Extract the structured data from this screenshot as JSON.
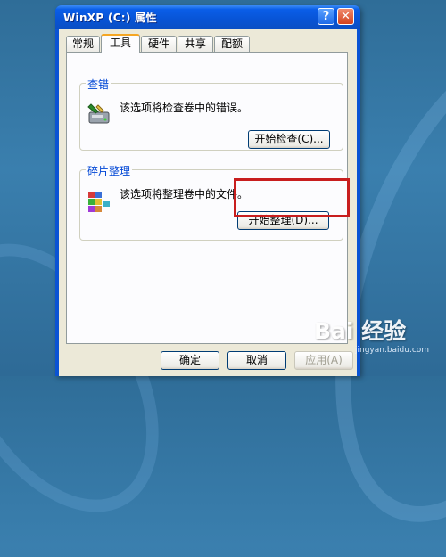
{
  "window": {
    "title": "WinXP (C:) 属性",
    "help_symbol": "?",
    "close_symbol": "✕"
  },
  "tabs": [
    {
      "label": "常规",
      "active": false
    },
    {
      "label": "工具",
      "active": true
    },
    {
      "label": "硬件",
      "active": false
    },
    {
      "label": "共享",
      "active": false
    },
    {
      "label": "配额",
      "active": false
    }
  ],
  "check_group": {
    "title": "查错",
    "description": "该选项将检查卷中的错误。",
    "button_label": "开始检查(C)...",
    "icon": "disk-check-icon"
  },
  "defrag_group": {
    "title": "碎片整理",
    "description": "该选项将整理卷中的文件。",
    "button_label": "开始整理(D)...",
    "icon": "defrag-icon"
  },
  "buttons": {
    "ok": "确定",
    "cancel": "取消",
    "apply": "应用(A)"
  },
  "watermark": {
    "brand": "Bai  经验",
    "url": "jingyan.baidu.com"
  },
  "colors": {
    "highlight": "#c81e1e",
    "titlebar": "#0854d6",
    "group_title": "#0046d5"
  }
}
